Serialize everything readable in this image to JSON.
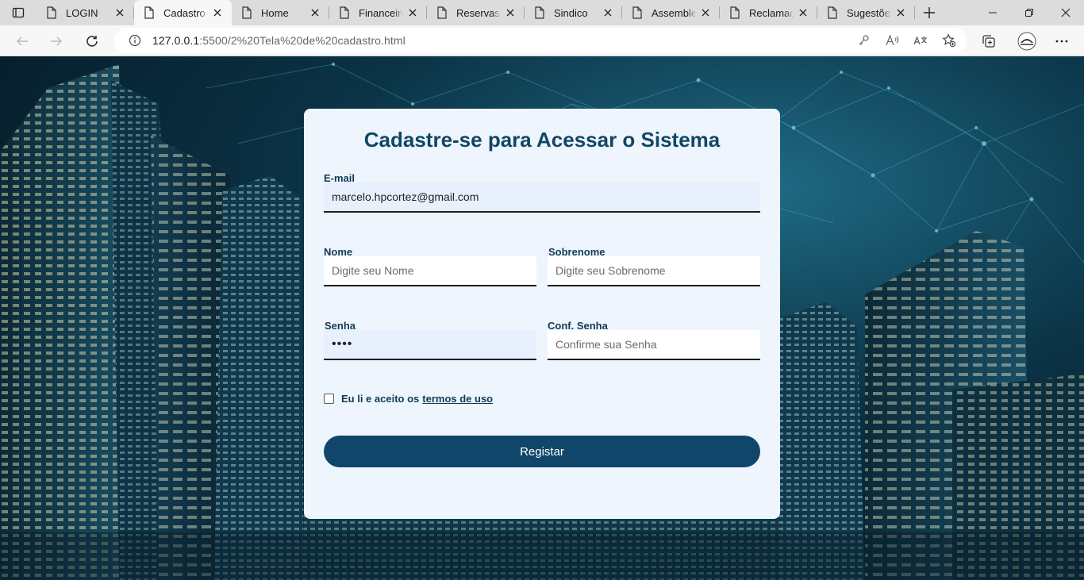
{
  "browser": {
    "tabs": [
      {
        "label": "LOGIN",
        "active": false
      },
      {
        "label": "Cadastro",
        "active": true
      },
      {
        "label": "Home",
        "active": false
      },
      {
        "label": "Financeiro",
        "active": false
      },
      {
        "label": "Reservas",
        "active": false
      },
      {
        "label": "Sindico",
        "active": false
      },
      {
        "label": "Assembleia",
        "active": false
      },
      {
        "label": "Reclamações",
        "active": false
      },
      {
        "label": "Sugestões",
        "active": false
      }
    ],
    "address": {
      "host": "127.0.0.1",
      "path": ":5500/2%20Tela%20de%20cadastro.html"
    }
  },
  "form": {
    "title": "Cadastre-se para Acessar o Sistema",
    "email": {
      "label": "E-mail",
      "value": "marcelo.hpcortez@gmail.com"
    },
    "nome": {
      "label": "Nome",
      "placeholder": "Digite seu Nome"
    },
    "sobrenome": {
      "label": "Sobrenome",
      "placeholder": "Digite seu Sobrenome"
    },
    "senha": {
      "label": "Senha",
      "value": "••••"
    },
    "conf_senha": {
      "label": "Conf. Senha",
      "placeholder": "Confirme sua Senha"
    },
    "terms_text": "Eu li e aceito os",
    "terms_link": "termos de uso",
    "terms_checked": false,
    "submit_label": "Registar"
  },
  "colors": {
    "primary": "#0f4669",
    "title": "#114766",
    "card_bg": "#eef5fd",
    "autofill_bg": "#e8f0fd"
  }
}
